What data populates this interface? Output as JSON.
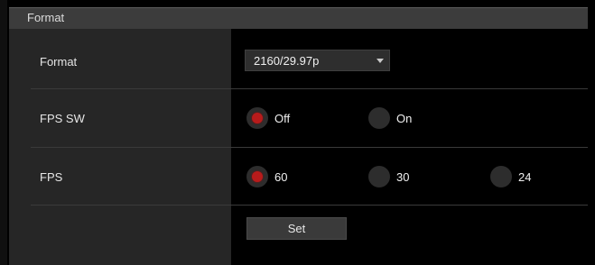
{
  "section": {
    "title": "Format"
  },
  "rows": {
    "format": {
      "label": "Format",
      "selected": "2160/29.97p"
    },
    "fps_sw": {
      "label": "FPS SW",
      "options": [
        "Off",
        "On"
      ],
      "selected": "Off"
    },
    "fps": {
      "label": "FPS",
      "options": [
        "60",
        "30",
        "24"
      ],
      "selected": "60"
    }
  },
  "actions": {
    "set_label": "Set"
  },
  "colors": {
    "radio_selected": "#b81b1b",
    "label_column_bg": "#262626",
    "header_bg": "#3c3c3c"
  }
}
